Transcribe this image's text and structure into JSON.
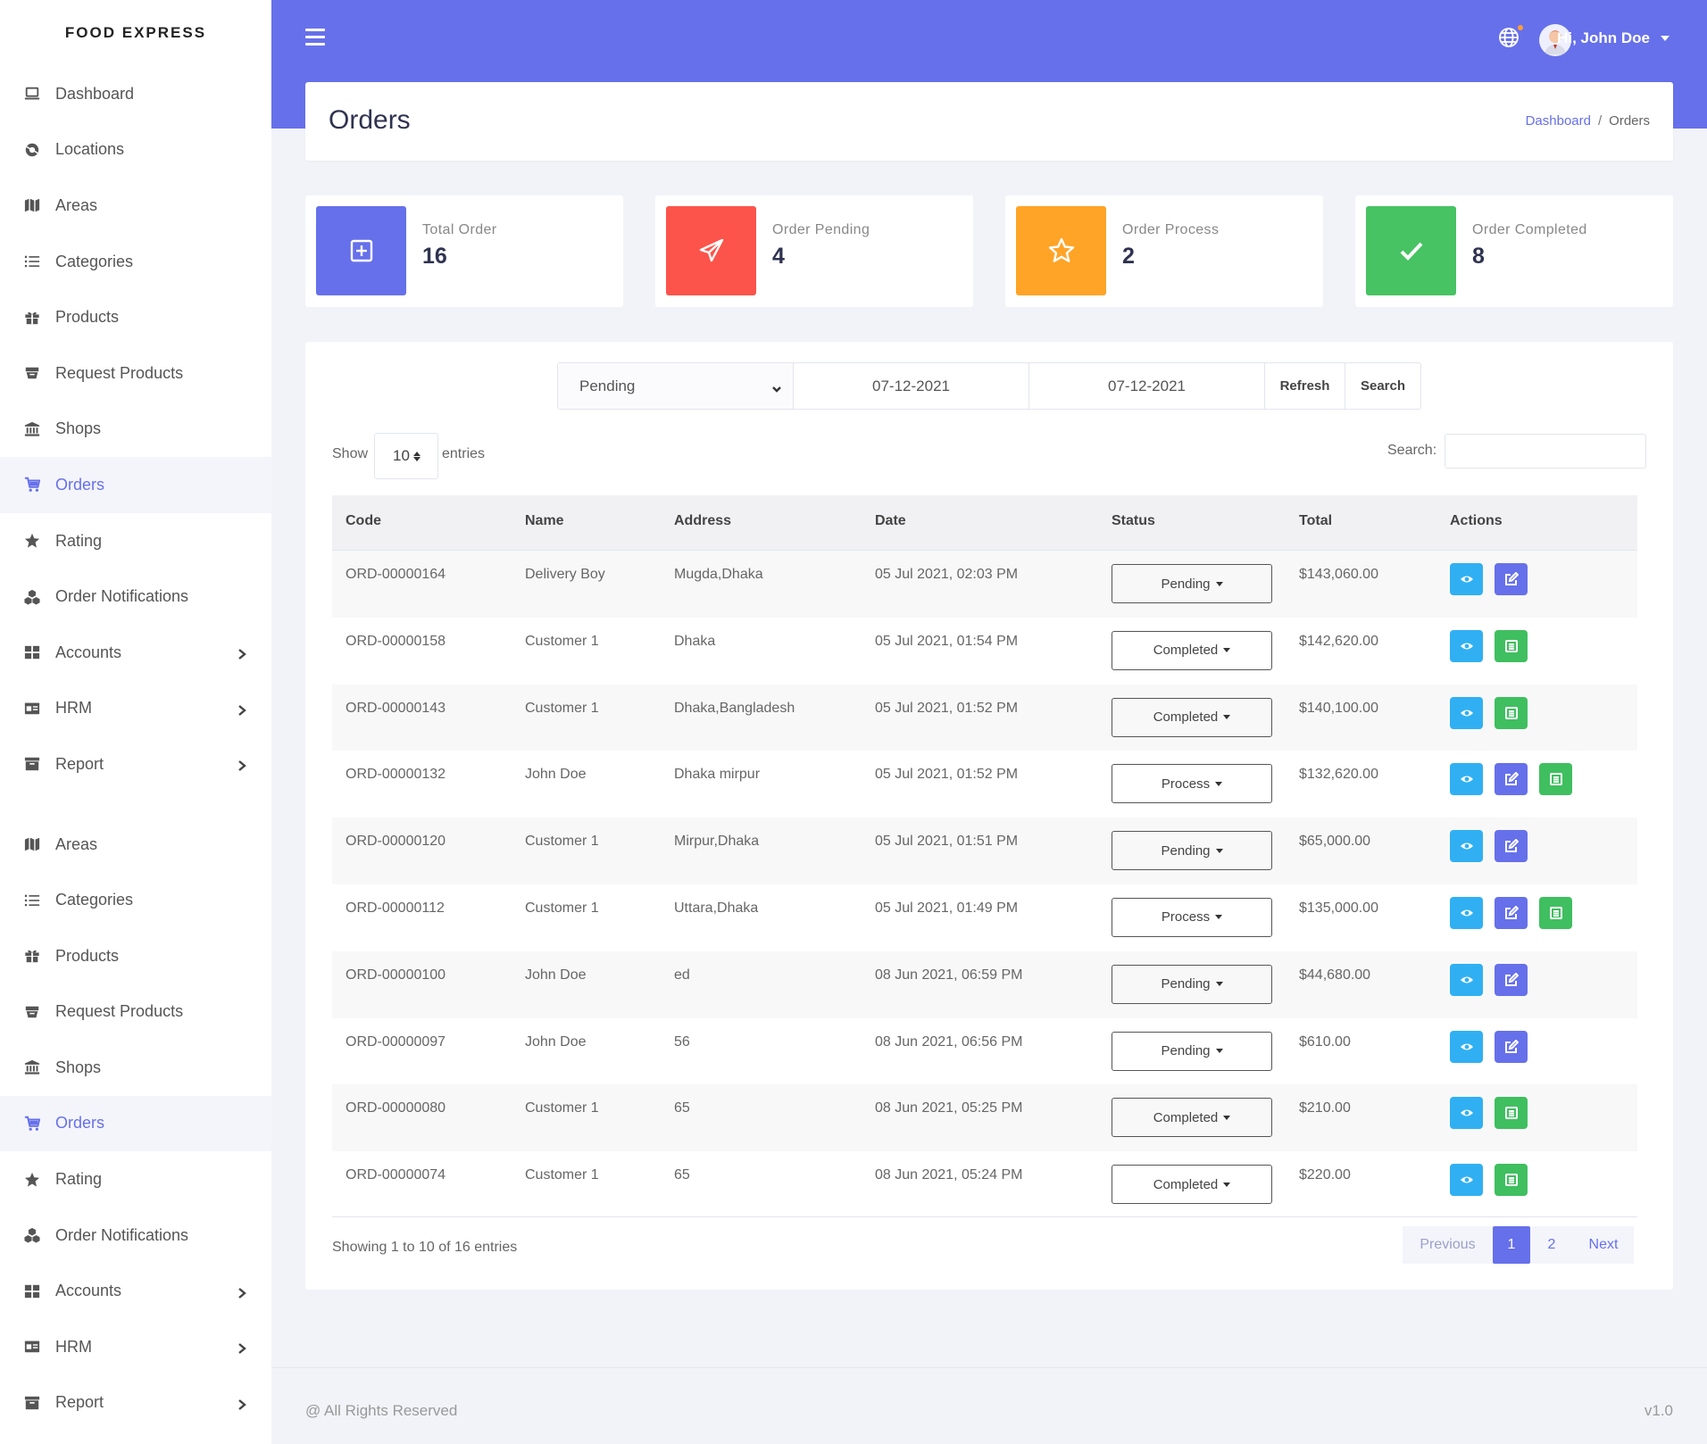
{
  "brand": "FOOD EXPRESS",
  "sidebar": {
    "items": [
      {
        "label": "Dashboard",
        "icon": "laptop-icon"
      },
      {
        "label": "Locations",
        "icon": "globe-pin-icon"
      },
      {
        "label": "Areas",
        "icon": "map-icon"
      },
      {
        "label": "Categories",
        "icon": "list-icon"
      },
      {
        "label": "Products",
        "icon": "gift-icon"
      },
      {
        "label": "Request Products",
        "icon": "archive-icon"
      },
      {
        "label": "Shops",
        "icon": "bank-icon"
      },
      {
        "label": "Orders",
        "icon": "cart-icon",
        "active": true
      },
      {
        "label": "Rating",
        "icon": "star-icon"
      },
      {
        "label": "Order Notifications",
        "icon": "cubes-icon"
      },
      {
        "label": "Accounts",
        "icon": "grid-icon",
        "chevron": true
      },
      {
        "label": "HRM",
        "icon": "id-card-icon",
        "chevron": true
      },
      {
        "label": "Report",
        "icon": "inbox-icon",
        "chevron": true
      }
    ],
    "items2": [
      {
        "label": "Areas",
        "icon": "map-icon"
      },
      {
        "label": "Categories",
        "icon": "list-icon"
      },
      {
        "label": "Products",
        "icon": "gift-icon"
      },
      {
        "label": "Request Products",
        "icon": "archive-icon"
      },
      {
        "label": "Shops",
        "icon": "bank-icon"
      },
      {
        "label": "Orders",
        "icon": "cart-icon",
        "active": true
      },
      {
        "label": "Rating",
        "icon": "star-icon"
      },
      {
        "label": "Order Notifications",
        "icon": "cubes-icon"
      },
      {
        "label": "Accounts",
        "icon": "grid-icon",
        "chevron": true
      },
      {
        "label": "HRM",
        "icon": "id-card-icon",
        "chevron": true
      },
      {
        "label": "Report",
        "icon": "inbox-icon",
        "chevron": true
      }
    ]
  },
  "header": {
    "user_greeting": "Hi, John Doe"
  },
  "page": {
    "title": "Orders",
    "breadcrumb": {
      "home": "Dashboard",
      "separator": "/",
      "current": "Orders"
    }
  },
  "stats": [
    {
      "label": "Total Order",
      "value": "16",
      "color": "#6670ea",
      "icon": "plus-square-icon"
    },
    {
      "label": "Order Pending",
      "value": "4",
      "color": "#fc544b",
      "icon": "paper-plane-icon"
    },
    {
      "label": "Order Process",
      "value": "2",
      "color": "#ffa426",
      "icon": "star-outline-icon"
    },
    {
      "label": "Order Completed",
      "value": "8",
      "color": "#47c363",
      "icon": "check-icon"
    }
  ],
  "filters": {
    "status_selected": "Pending",
    "date_from": "07-12-2021",
    "date_to": "07-12-2021",
    "refresh_label": "Refresh",
    "search_label": "Search"
  },
  "table_controls": {
    "show_label": "Show",
    "page_length": "10",
    "entries_label": "entries",
    "search_label": "Search:"
  },
  "table": {
    "headers": [
      "Code",
      "Name",
      "Address",
      "Date",
      "Status",
      "Total",
      "Actions"
    ],
    "rows": [
      {
        "code": "ORD-00000164",
        "name": "Delivery Boy",
        "address": "Mugda,Dhaka",
        "date": "05 Jul 2021, 02:03 PM",
        "status": "Pending",
        "total": "$143,060.00",
        "actions": [
          "view",
          "edit"
        ]
      },
      {
        "code": "ORD-00000158",
        "name": "Customer 1",
        "address": "Dhaka",
        "date": "05 Jul 2021, 01:54 PM",
        "status": "Completed",
        "total": "$142,620.00",
        "actions": [
          "view",
          "invoice"
        ]
      },
      {
        "code": "ORD-00000143",
        "name": "Customer 1",
        "address": "Dhaka,Bangladesh",
        "date": "05 Jul 2021, 01:52 PM",
        "status": "Completed",
        "total": "$140,100.00",
        "actions": [
          "view",
          "invoice"
        ]
      },
      {
        "code": "ORD-00000132",
        "name": "John Doe",
        "address": "Dhaka mirpur",
        "date": "05 Jul 2021, 01:52 PM",
        "status": "Process",
        "total": "$132,620.00",
        "actions": [
          "view",
          "edit",
          "invoice"
        ]
      },
      {
        "code": "ORD-00000120",
        "name": "Customer 1",
        "address": "Mirpur,Dhaka",
        "date": "05 Jul 2021, 01:51 PM",
        "status": "Pending",
        "total": "$65,000.00",
        "actions": [
          "view",
          "edit"
        ]
      },
      {
        "code": "ORD-00000112",
        "name": "Customer 1",
        "address": "Uttara,Dhaka",
        "date": "05 Jul 2021, 01:49 PM",
        "status": "Process",
        "total": "$135,000.00",
        "actions": [
          "view",
          "edit",
          "invoice"
        ]
      },
      {
        "code": "ORD-00000100",
        "name": "John Doe",
        "address": "ed",
        "date": "08 Jun 2021, 06:59 PM",
        "status": "Pending",
        "total": "$44,680.00",
        "actions": [
          "view",
          "edit"
        ]
      },
      {
        "code": "ORD-00000097",
        "name": "John Doe",
        "address": "56",
        "date": "08 Jun 2021, 06:56 PM",
        "status": "Pending",
        "total": "$610.00",
        "actions": [
          "view",
          "edit"
        ]
      },
      {
        "code": "ORD-00000080",
        "name": "Customer 1",
        "address": "65",
        "date": "08 Jun 2021, 05:25 PM",
        "status": "Completed",
        "total": "$210.00",
        "actions": [
          "view",
          "invoice"
        ]
      },
      {
        "code": "ORD-00000074",
        "name": "Customer 1",
        "address": "65",
        "date": "08 Jun 2021, 05:24 PM",
        "status": "Completed",
        "total": "$220.00",
        "actions": [
          "view",
          "invoice"
        ]
      }
    ]
  },
  "pagination": {
    "showing_text": "Showing 1 to 10 of 16 entries",
    "previous": "Previous",
    "pages": [
      "1",
      "2"
    ],
    "current_page": "1",
    "next": "Next"
  },
  "footer": {
    "copyright": "@ All Rights Reserved",
    "version": "v1.0"
  }
}
